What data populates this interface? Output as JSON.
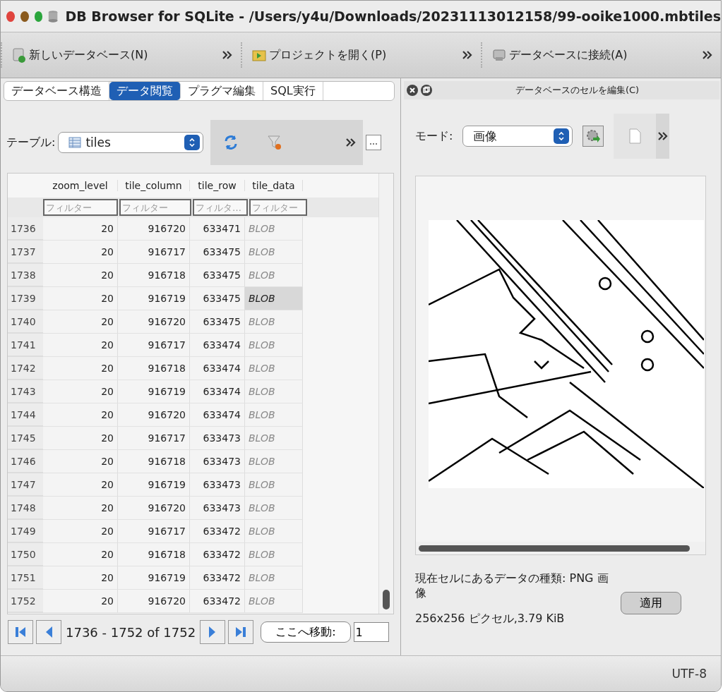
{
  "window": {
    "title": "DB Browser for SQLite - /Users/y4u/Downloads/20231113012158/99-ooike1000.mbtiles"
  },
  "toolbar": [
    {
      "label": "新しいデータベース(N)",
      "kind": "new"
    },
    {
      "label": "プロジェクトを開く(P)",
      "kind": "open"
    },
    {
      "label": "データベースに接続(A)",
      "kind": "connect"
    }
  ],
  "tabs": [
    {
      "label": "データベース構造",
      "selected": false
    },
    {
      "label": "データ閲覧",
      "selected": true
    },
    {
      "label": "プラグマ編集",
      "selected": false
    },
    {
      "label": "SQL実行",
      "selected": false
    }
  ],
  "table_picker": {
    "label": "テーブル:",
    "value": "tiles"
  },
  "table": {
    "columns": [
      {
        "name": "zoom_level",
        "placeholder": "フィルター"
      },
      {
        "name": "tile_column",
        "placeholder": "フィルター"
      },
      {
        "name": "tile_row",
        "placeholder": "フィルタ…"
      },
      {
        "name": "tile_data",
        "placeholder": "フィルター"
      }
    ],
    "rows": [
      {
        "id": "1736",
        "cells": [
          "20",
          "916720",
          "633471",
          "BLOB"
        ],
        "selected": false
      },
      {
        "id": "1737",
        "cells": [
          "20",
          "916717",
          "633475",
          "BLOB"
        ],
        "selected": false
      },
      {
        "id": "1738",
        "cells": [
          "20",
          "916718",
          "633475",
          "BLOB"
        ],
        "selected": false
      },
      {
        "id": "1739",
        "cells": [
          "20",
          "916719",
          "633475",
          "BLOB"
        ],
        "selected": true
      },
      {
        "id": "1740",
        "cells": [
          "20",
          "916720",
          "633475",
          "BLOB"
        ],
        "selected": false
      },
      {
        "id": "1741",
        "cells": [
          "20",
          "916717",
          "633474",
          "BLOB"
        ],
        "selected": false
      },
      {
        "id": "1742",
        "cells": [
          "20",
          "916718",
          "633474",
          "BLOB"
        ],
        "selected": false
      },
      {
        "id": "1743",
        "cells": [
          "20",
          "916719",
          "633474",
          "BLOB"
        ],
        "selected": false
      },
      {
        "id": "1744",
        "cells": [
          "20",
          "916720",
          "633474",
          "BLOB"
        ],
        "selected": false
      },
      {
        "id": "1745",
        "cells": [
          "20",
          "916717",
          "633473",
          "BLOB"
        ],
        "selected": false
      },
      {
        "id": "1746",
        "cells": [
          "20",
          "916718",
          "633473",
          "BLOB"
        ],
        "selected": false
      },
      {
        "id": "1747",
        "cells": [
          "20",
          "916719",
          "633473",
          "BLOB"
        ],
        "selected": false
      },
      {
        "id": "1748",
        "cells": [
          "20",
          "916720",
          "633473",
          "BLOB"
        ],
        "selected": false
      },
      {
        "id": "1749",
        "cells": [
          "20",
          "916717",
          "633472",
          "BLOB"
        ],
        "selected": false
      },
      {
        "id": "1750",
        "cells": [
          "20",
          "916718",
          "633472",
          "BLOB"
        ],
        "selected": false
      },
      {
        "id": "1751",
        "cells": [
          "20",
          "916719",
          "633472",
          "BLOB"
        ],
        "selected": false
      },
      {
        "id": "1752",
        "cells": [
          "20",
          "916720",
          "633472",
          "BLOB"
        ],
        "selected": false
      }
    ]
  },
  "pager": {
    "range": "1736 - 1752 of 1752",
    "goto_label": "ここへ移動:",
    "goto_value": "1"
  },
  "cell_editor": {
    "title": "データベースのセルを編集(C)",
    "mode_label": "モード:",
    "mode_value": "画像",
    "type_text": "現在セルにあるデータの種類: PNG 画像",
    "size_text": "256x256 ピクセル,3.79 KiB",
    "apply": "適用"
  },
  "status_bar": {
    "encoding": "UTF-8"
  }
}
